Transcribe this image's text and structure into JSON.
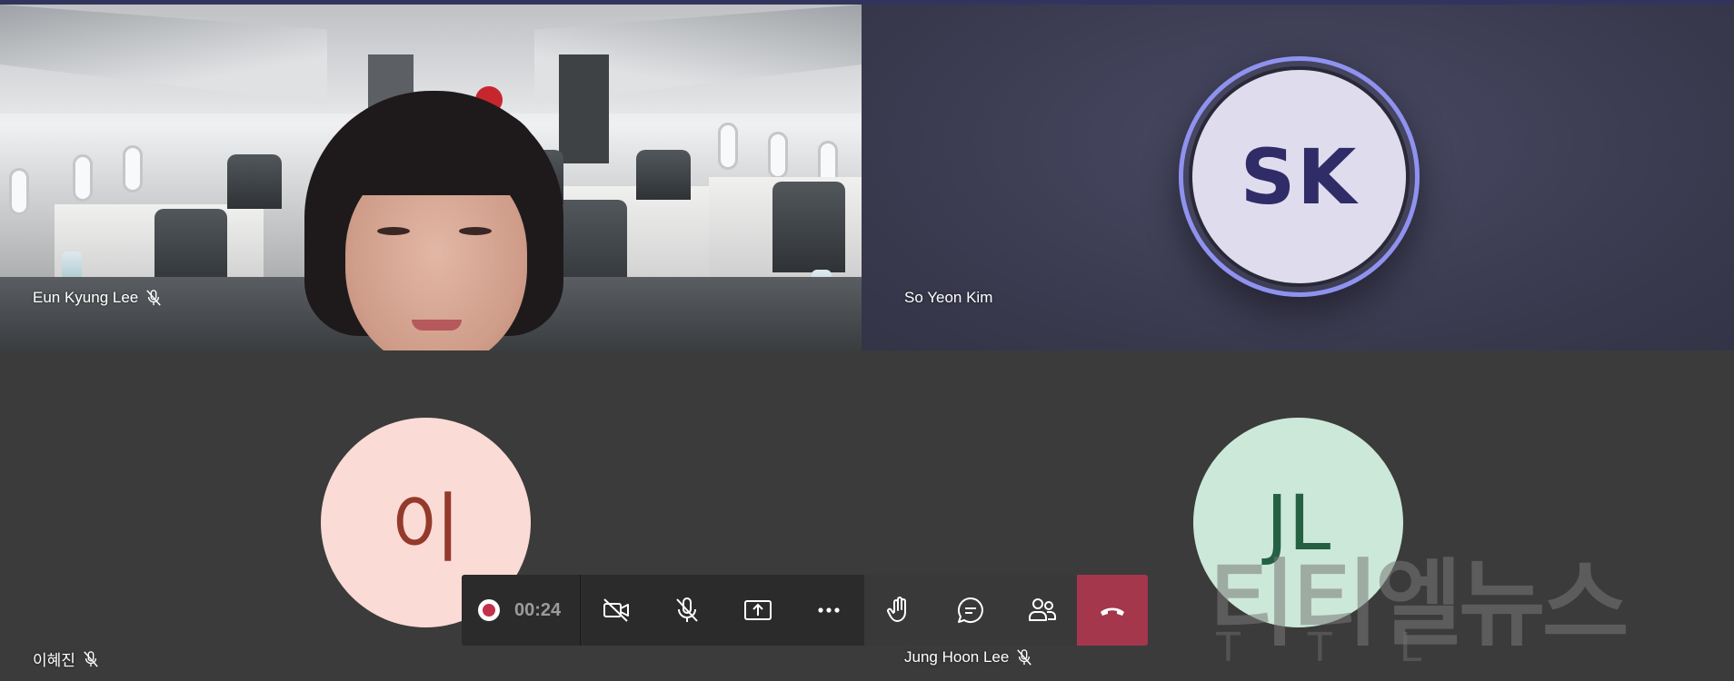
{
  "participants": [
    {
      "name": "Eun Kyung Lee",
      "muted": true,
      "type": "video"
    },
    {
      "name": "So Yeon Kim",
      "initials": "SK",
      "type": "avatar",
      "speaking": true
    },
    {
      "name": "이혜진",
      "initials": "이",
      "muted": true,
      "type": "avatar"
    },
    {
      "name": "Jung Hoon Lee",
      "initials": "JL",
      "muted": true,
      "type": "avatar"
    }
  ],
  "toolbar": {
    "recording": true,
    "timer": "00:24",
    "buttons": [
      {
        "id": "camera",
        "icon": "camera-off-icon"
      },
      {
        "id": "mic",
        "icon": "mic-off-icon"
      },
      {
        "id": "share",
        "icon": "share-screen-icon"
      },
      {
        "id": "more",
        "icon": "more-icon"
      },
      {
        "id": "raise-hand",
        "icon": "hand-icon"
      },
      {
        "id": "chat",
        "icon": "chat-icon"
      },
      {
        "id": "participants",
        "icon": "people-icon"
      },
      {
        "id": "hangup",
        "icon": "hangup-icon"
      }
    ]
  },
  "watermark": {
    "main": "티티엘뉴스",
    "sub": "T T L"
  },
  "colors": {
    "accent_ring": "#8f92ef",
    "hangup": "#a4374b",
    "record": "#c4314b",
    "topline": "#33345e"
  }
}
